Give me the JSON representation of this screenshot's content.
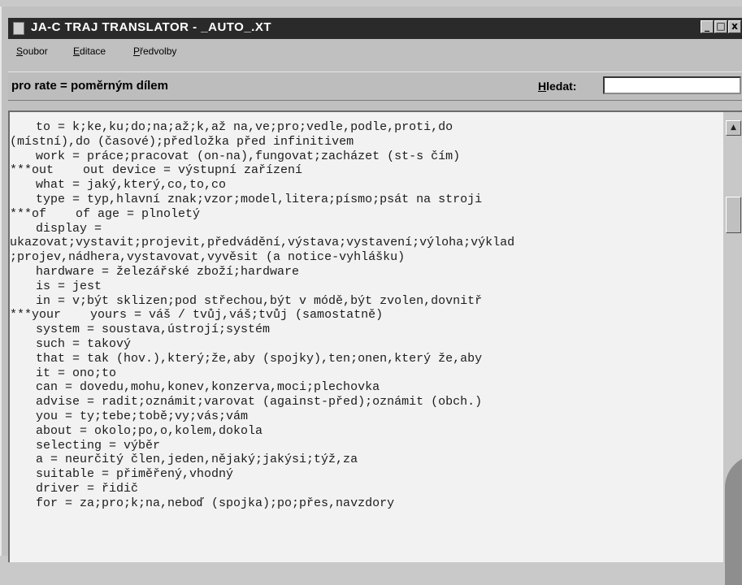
{
  "window": {
    "title": "JA-C TRAJ TRANSLATOR - _AUTO_.XT",
    "controls": {
      "minimize": "_",
      "maximize": "□",
      "close": "x"
    }
  },
  "menu": {
    "soubor": {
      "mnemonic": "S",
      "rest": "oubor"
    },
    "editace": {
      "mnemonic": "E",
      "rest": "ditace"
    },
    "predvolby": {
      "mnemonic": "P",
      "rest": "ředvolby"
    }
  },
  "toolbar": {
    "current_entry": "pro rate = poměrným dílem",
    "search_label_mnemonic": "H",
    "search_label_rest": "ledat:",
    "search_value": ""
  },
  "dictionary": {
    "lines": [
      "to = k;ke,ku;do;na;až;k,až na,ve;pro;vedle,podle,proti,do",
      "(místní),do (časové);předložka před infinitivem",
      "work = práce;pracovat (on-na),fungovat;zacházet (st-s čím)",
      "***out    out device = výstupní zařízení",
      "what = jaký,který,co,to,co",
      "type = typ,hlavní znak;vzor;model,litera;písmo;psát na stroji",
      "***of    of age = plnoletý",
      "display =",
      "ukazovat;vystavit;projevit,předvádění,výstava;vystavení;výloha;výklad",
      ";projev,nádhera,vystavovat,vyvěsit (a notice-vyhlášku)",
      "hardware = železářské zboží;hardware",
      "is = jest",
      "in = v;být sklizen;pod střechou,být v módě,být zvolen,dovnitř",
      "***your    yours = váš / tvůj,váš;tvůj (samostatně)",
      "system = soustava,ústrojí;systém",
      "such = takový",
      "that = tak (hov.),který;že,aby (spojky),ten;onen,který že,aby",
      "it = ono;to",
      "can = dovedu,mohu,konev,konzerva,moci;plechovka",
      "advise = radit;oznámit;varovat (against-před);oznámit (obch.)",
      "you = ty;tebe;tobě;vy;vás;vám",
      "about = okolo;po,o,kolem,dokola",
      "selecting = výběr",
      "a = neurčitý člen,jeden,nějaký;jakýsi;týž,za",
      "suitable = přiměřený,vhodný",
      "driver = řidič",
      "for = za;pro;k;na,neboď (spojka);po;přes,navzdory"
    ]
  },
  "scrollbar": {
    "up_arrow": "▲"
  }
}
